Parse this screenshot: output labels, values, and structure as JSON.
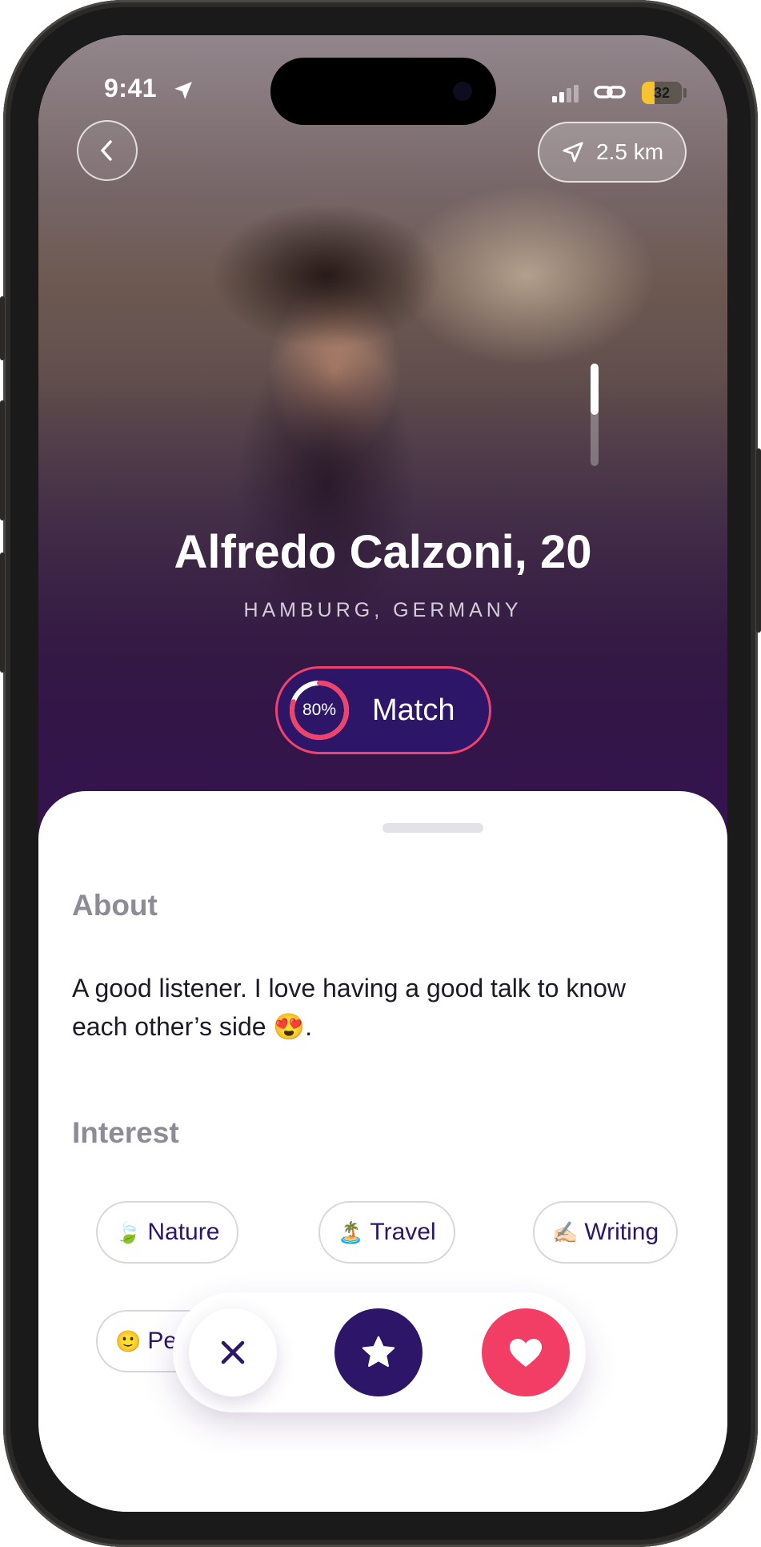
{
  "status_bar": {
    "time": "9:41",
    "battery": "32",
    "battery_level": 0.32
  },
  "header": {
    "distance": "2.5 km"
  },
  "photo_scroll": {
    "position": 0.5
  },
  "profile": {
    "name": "Alfredo Calzoni, 20",
    "location": "HAMBURG, GERMANY",
    "match_percent": "80%",
    "match_value": 0.8,
    "match_label": "Match"
  },
  "about": {
    "heading": "About",
    "text": "A good listener. I love having a good talk to know each other’s side 😍."
  },
  "interest": {
    "heading": "Interest",
    "chips": [
      {
        "emoji": "🍃",
        "label": "Nature"
      },
      {
        "emoji": "🏝️",
        "label": "Travel"
      },
      {
        "emoji": "✍🏻",
        "label": "Writing"
      },
      {
        "emoji": "🙂",
        "label": "Pe"
      }
    ]
  },
  "colors": {
    "brand": "#2d1567",
    "accent": "#f23e64",
    "muted_heading": "#8e8b96"
  },
  "actions": {
    "dismiss_icon": "close-icon",
    "super_like_icon": "star-icon",
    "like_icon": "heart-icon"
  }
}
